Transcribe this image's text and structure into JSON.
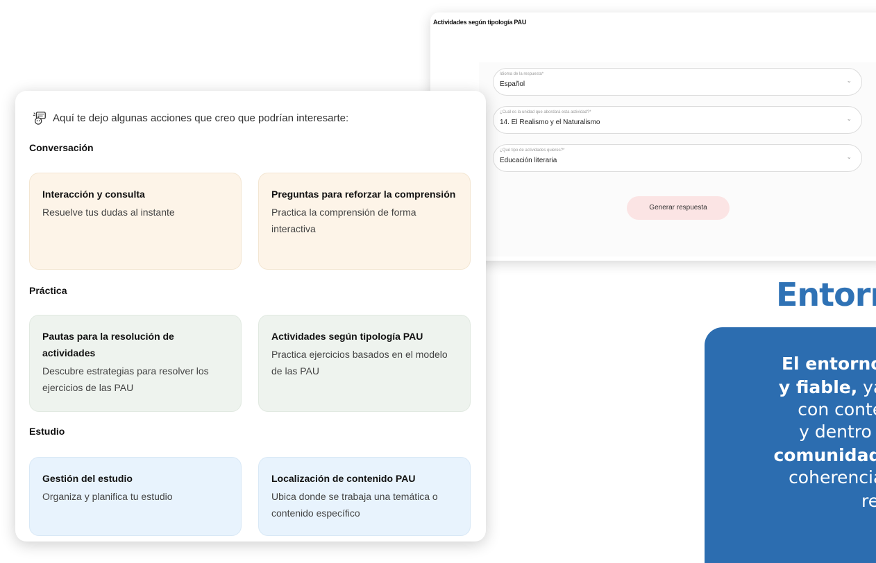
{
  "form": {
    "title": "Actividades según tipología PAU",
    "fields": [
      {
        "label": "Idioma de la respuesta*",
        "value": "Español"
      },
      {
        "label": "¿Cuál es la unidad que abordará esta actividad?*",
        "value": "14. El Realismo y el Naturalismo"
      },
      {
        "label": "¿Qué tipo de actividades quieres?*",
        "value": "Educación literaria"
      }
    ],
    "generate_label": "Generar respuesta"
  },
  "right": {
    "heading": "Entorn",
    "lines": [
      {
        "bold": "El entorno c",
        "rest": ""
      },
      {
        "bold": "y fiable,",
        "rest": " ya c"
      },
      {
        "bold": "",
        "rest": "con conteni"
      },
      {
        "bold": "",
        "rest": "y dentro de"
      },
      {
        "bold": "comunidad e",
        "rest": ""
      },
      {
        "bold": "",
        "rest": "coherencia c"
      },
      {
        "bold": "",
        "rest": "resp"
      }
    ]
  },
  "suggestions": {
    "intro": "Aquí te dejo algunas acciones que creo que podrían interesarte:",
    "sections": [
      {
        "title": "Conversación",
        "items": [
          {
            "title": "Interacción y consulta",
            "desc": "Resuelve tus dudas al instante"
          },
          {
            "title": "Preguntas para reforzar la comprensión",
            "desc": "Practica la comprensión de forma interactiva"
          }
        ]
      },
      {
        "title": "Práctica",
        "items": [
          {
            "title": "Pautas para la resolución de actividades",
            "desc": "Descubre estrategias para resolver los ejercicios de las PAU"
          },
          {
            "title": "Actividades según tipología PAU",
            "desc": "Practica ejercicios basados en el modelo de las PAU"
          }
        ]
      },
      {
        "title": "Estudio",
        "items": [
          {
            "title": "Gestión del estudio",
            "desc": "Organiza y planifica tu estudio"
          },
          {
            "title": "Localización de contenido PAU",
            "desc": "Ubica donde se trabaja una temática o contenido específico"
          }
        ]
      }
    ]
  },
  "colors": {
    "accent_blue": "#2c6db0",
    "tile_orange": "#fdf4e8",
    "tile_green": "#eef3ee",
    "tile_blue": "#e8f3fd",
    "generate_button": "#fbe4e4"
  },
  "icons": {
    "intro": "robot-assistant-icon",
    "field_dropdown": "chevron-down-icon"
  }
}
